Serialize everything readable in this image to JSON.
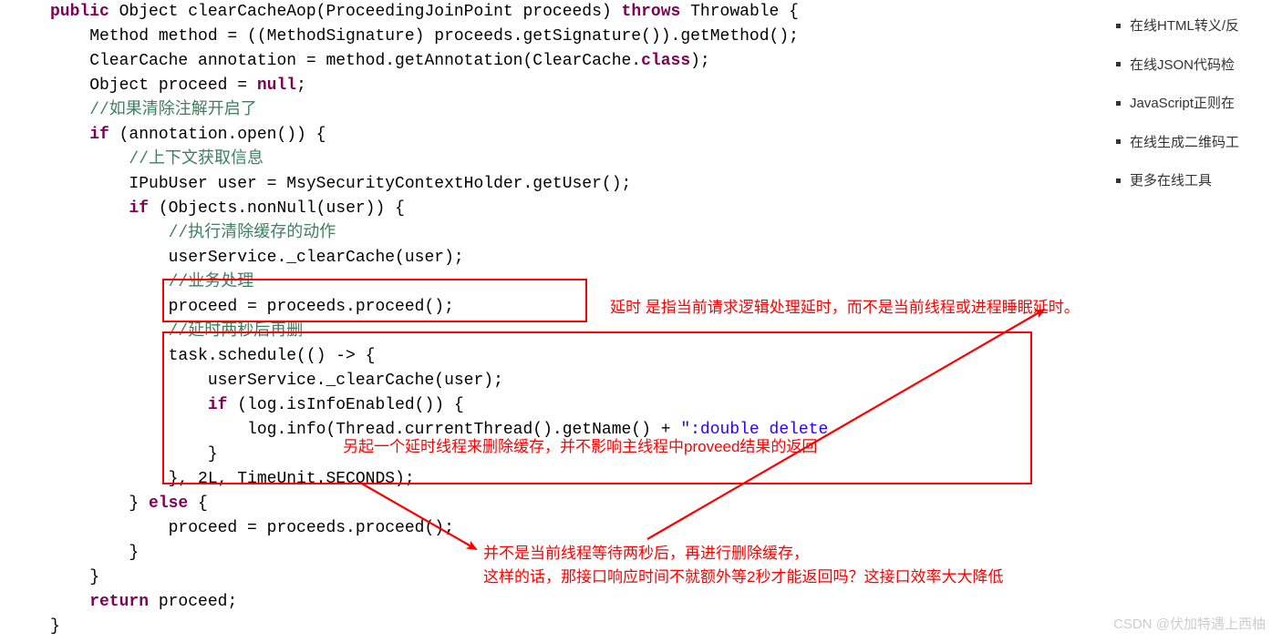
{
  "code": {
    "l1": {
      "kw1": "public",
      "a": " Object clearCacheAop(ProceedingJoinPoint proceeds) ",
      "kw2": "throws",
      "b": " Throwable {"
    },
    "l2": "    Method method = ((MethodSignature) proceeds.getSignature()).getMethod();",
    "l3": {
      "a": "    ClearCache annotation = method.getAnnotation(ClearCache.",
      "kw": "class",
      "b": ");"
    },
    "l4": {
      "a": "    Object proceed = ",
      "kw": "null",
      "b": ";"
    },
    "l5": "    //如果清除注解开启了",
    "l6": {
      "kw": "    if",
      "a": " (annotation.open()) {"
    },
    "l7": "        //上下文获取信息",
    "l8": "        IPubUser user = MsySecurityContextHolder.getUser();",
    "l9": {
      "kw": "        if",
      "a": " (Objects.nonNull(user)) {"
    },
    "l10": "            //执行清除缓存的动作",
    "l11": "            userService._clearCache(user);",
    "l12": "            //业务处理",
    "l13": "            proceed = proceeds.proceed();",
    "l14": "            //延时两秒后再删",
    "l15": "            task.schedule(() -> {",
    "l16": "                userService._clearCache(user);",
    "l17": {
      "kw": "                if",
      "a": " (log.isInfoEnabled()) {"
    },
    "l18": {
      "a": "                    log.info(Thread.currentThread().getName() + ",
      "s": "\":double delete"
    },
    "l19": "                }",
    "l20": "            }, 2L, TimeUnit.SECONDS);",
    "l21": {
      "a": "        } ",
      "kw": "else",
      "b": " {"
    },
    "l22": "            proceed = proceeds.proceed();",
    "l23": "        }",
    "l24": "    }",
    "l25": {
      "kw": "    return",
      "a": " proceed;"
    },
    "l26": "}"
  },
  "sidebar": {
    "items": [
      "在线HTML转义/反",
      "在线JSON代码检",
      "JavaScript正则在",
      "在线生成二维码工",
      "更多在线工具"
    ]
  },
  "annot": {
    "a1": "延时 是指当前请求逻辑处理延时，而不是当前线程或进程睡眠延时。",
    "a2": "另起一个延时线程来删除缓存，并不影响主线程中proveed结果的返回",
    "a3_l1": "并不是当前线程等待两秒后，再进行删除缓存，",
    "a3_l2": "这样的话，那接口响应时间不就额外等2秒才能返回吗？这接口效率大大降低"
  },
  "watermark": "CSDN @伏加特遇上西柚"
}
